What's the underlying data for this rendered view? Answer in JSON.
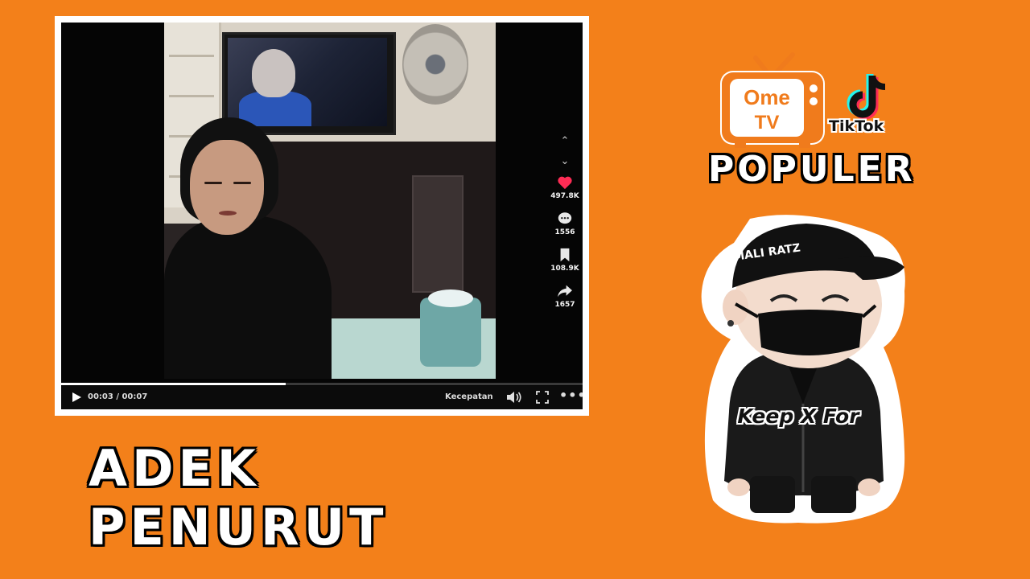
{
  "video": {
    "actions": [
      {
        "icon": "heart-icon",
        "count": "497.8K"
      },
      {
        "icon": "comment-icon",
        "count": "1556"
      },
      {
        "icon": "bookmark-icon",
        "count": "108.9K"
      },
      {
        "icon": "share-icon",
        "count": "1657"
      }
    ],
    "time": "00:03 / 00:07",
    "progress": 0.43,
    "speed_label": "Kecepatan",
    "more": "•••"
  },
  "caption": "ADEK PENURUT",
  "brand": {
    "ome_line1": "Ome",
    "ome_line2": "TV",
    "tiktok": "TikTok",
    "populer": "POPULER"
  },
  "sticker": {
    "cap_text": "MALI RATZ",
    "label": "Keep X For"
  },
  "colors": {
    "background": "#f3801a",
    "heart": "#fe2c55",
    "ome_orange": "#f07b1c"
  }
}
